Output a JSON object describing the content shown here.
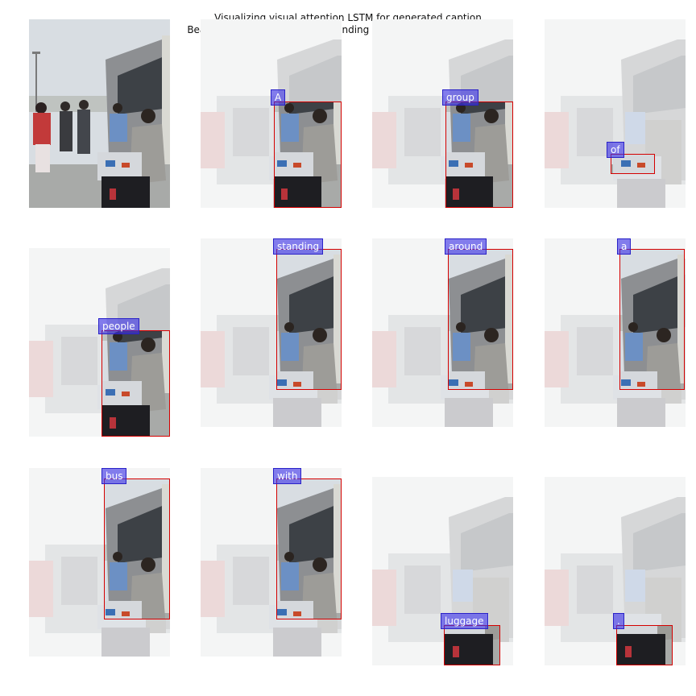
{
  "figure": {
    "title": "Visualizing visual attention LSTM for generated caption",
    "subtitle": "Beam: 0, \"A group of people standing around a bus with luggage.\""
  },
  "panels": [
    {
      "kind": "original",
      "word": ""
    },
    {
      "kind": "attention",
      "word": "A"
    },
    {
      "kind": "attention",
      "word": "group"
    },
    {
      "kind": "attention",
      "word": "of"
    },
    {
      "kind": "attention",
      "word": "people"
    },
    {
      "kind": "attention",
      "word": "standing"
    },
    {
      "kind": "attention",
      "word": "around"
    },
    {
      "kind": "attention",
      "word": "a"
    },
    {
      "kind": "attention",
      "word": "bus"
    },
    {
      "kind": "attention",
      "word": "with"
    },
    {
      "kind": "attention",
      "word": ""
    },
    {
      "kind": "attention",
      "word": "luggage"
    },
    {
      "kind": "attention",
      "word": "."
    }
  ],
  "colors": {
    "bounding_box": "#d40000",
    "word_label_bg": "#5a4fe6",
    "sky": "#d6dbe0",
    "bus": "#8a8c8f",
    "ground": "#a5a7a5"
  }
}
